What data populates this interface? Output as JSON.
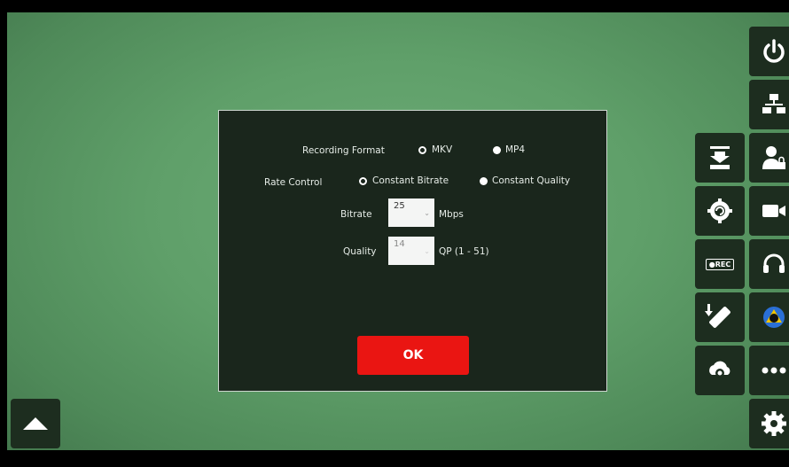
{
  "dialog": {
    "recording_format": {
      "label": "Recording Format",
      "options": [
        {
          "label": "MKV",
          "selected": true
        },
        {
          "label": "MP4",
          "selected": false
        }
      ]
    },
    "rate_control": {
      "label": "Rate Control",
      "options": [
        {
          "label": "Constant Bitrate",
          "selected": true
        },
        {
          "label": "Constant Quality",
          "selected": false
        }
      ]
    },
    "bitrate": {
      "label": "Bitrate",
      "value": "25",
      "unit": "Mbps",
      "enabled": true
    },
    "quality": {
      "label": "Quality",
      "value": "14",
      "unit": "QP (1 - 51)",
      "enabled": false
    },
    "ok_label": "OK"
  },
  "side_buttons": {
    "rec_label": "●REC"
  },
  "colors": {
    "background_green": "#5f9f69",
    "panel": "#1a261c",
    "button_bg": "#1d2d1f",
    "ok_red": "#ea1512"
  }
}
